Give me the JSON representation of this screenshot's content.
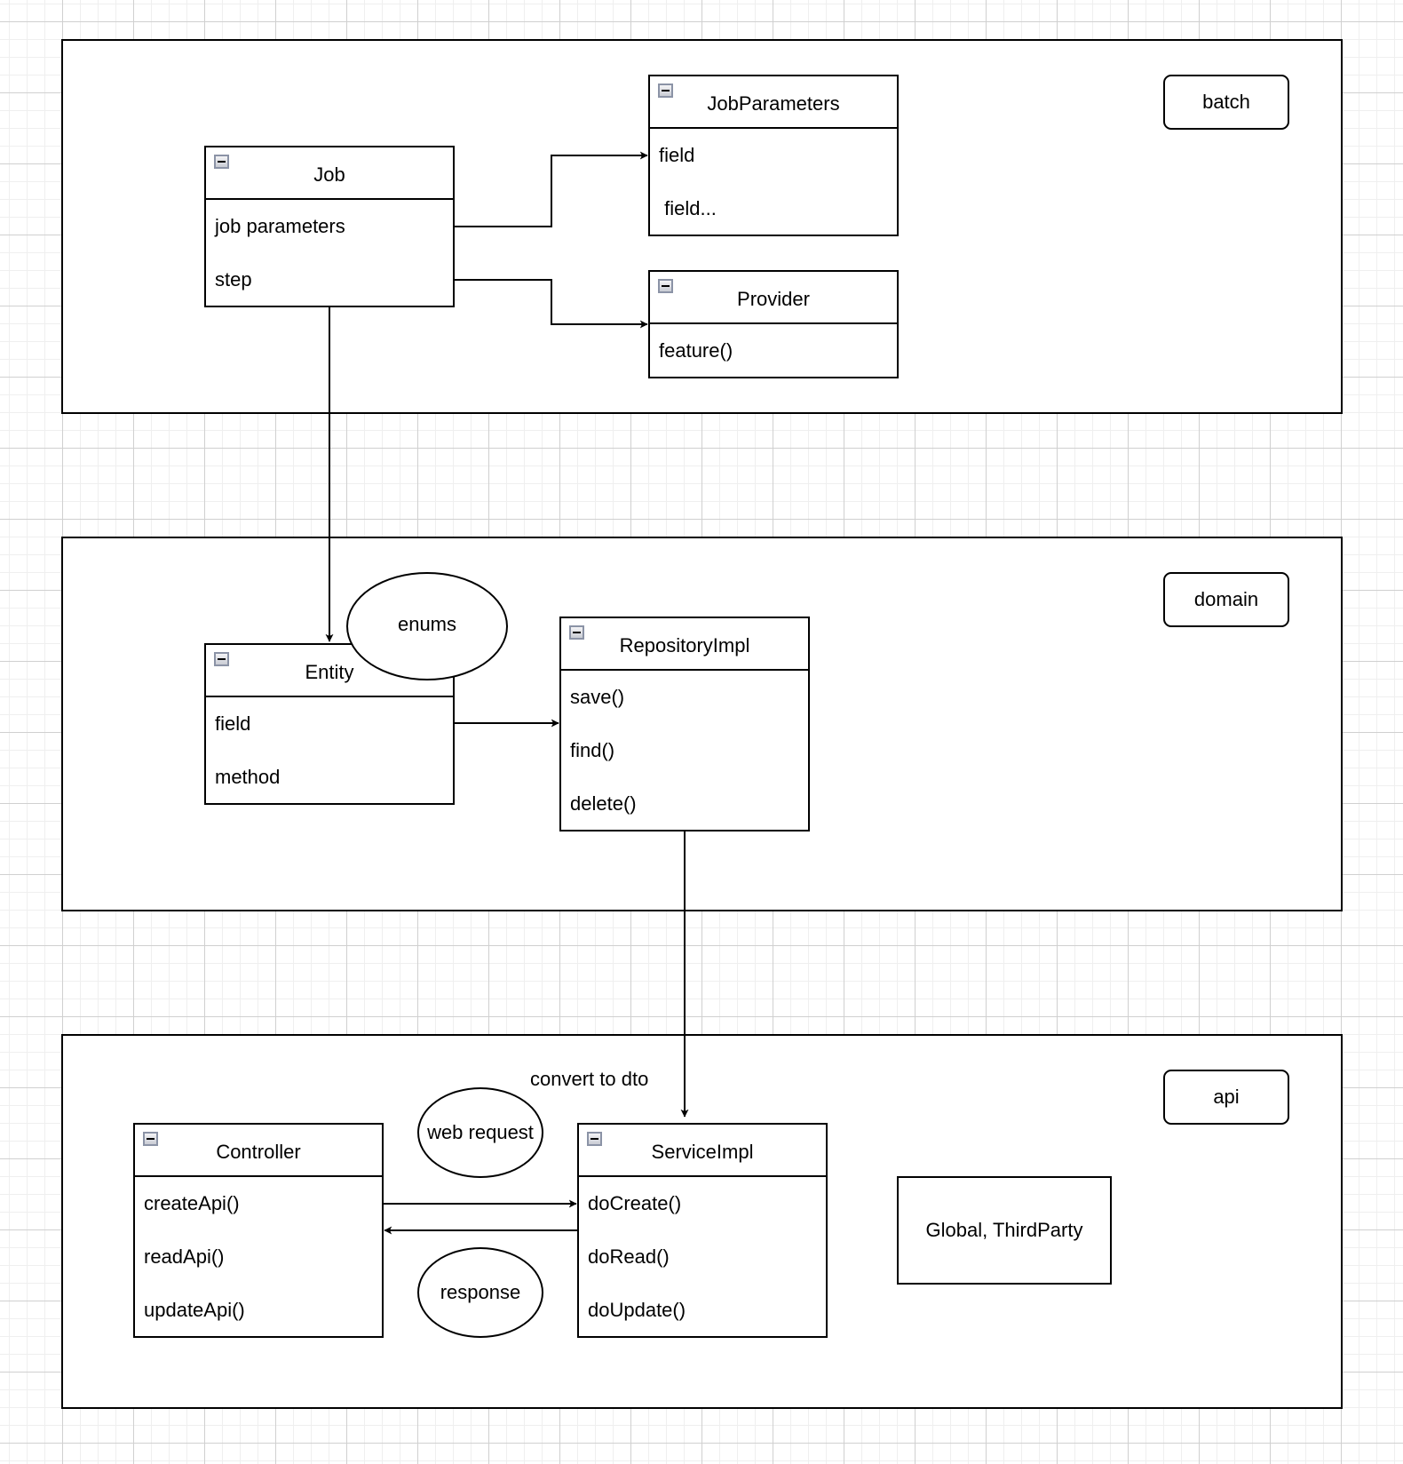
{
  "colors": {
    "stroke": "#000000",
    "grid_major": "#d0d0d0",
    "grid_minor": "#efefef",
    "background": "#ffffff"
  },
  "icons": {
    "collapse": "minus-square-icon"
  },
  "layers": [
    {
      "id": "batch",
      "label": "batch"
    },
    {
      "id": "domain",
      "label": "domain"
    },
    {
      "id": "api",
      "label": "api"
    }
  ],
  "classes": {
    "job": {
      "title": "Job",
      "rows": [
        "job parameters",
        "step"
      ]
    },
    "job_parameters": {
      "title": "JobParameters",
      "rows": [
        "field",
        " field..."
      ]
    },
    "provider": {
      "title": "Provider",
      "rows": [
        "feature()"
      ]
    },
    "entity": {
      "title": "Entity",
      "rows": [
        "field",
        "method"
      ]
    },
    "repository_impl": {
      "title": "RepositoryImpl",
      "rows": [
        "save()",
        "find()",
        "delete()"
      ]
    },
    "controller": {
      "title": "Controller",
      "rows": [
        "createApi()",
        "readApi()",
        "updateApi()"
      ]
    },
    "service_impl": {
      "title": "ServiceImpl",
      "rows": [
        "doCreate()",
        "doRead()",
        "doUpdate()"
      ]
    }
  },
  "ellipses": {
    "enums": "enums",
    "web_request": "web request",
    "response": "response"
  },
  "notes": {
    "convert_to_dto": "convert to dto",
    "global_thirdparty": "Global, ThirdParty"
  },
  "edges": [
    {
      "from": "Job.job parameters",
      "to": "JobParameters"
    },
    {
      "from": "Job.step",
      "to": "Provider"
    },
    {
      "from": "Job",
      "to": "Entity"
    },
    {
      "from": "Entity",
      "to": "RepositoryImpl"
    },
    {
      "from": "RepositoryImpl",
      "to": "ServiceImpl"
    },
    {
      "from": "Controller.createApi()",
      "to": "ServiceImpl.doCreate()"
    },
    {
      "from": "ServiceImpl",
      "to": "Controller"
    }
  ]
}
